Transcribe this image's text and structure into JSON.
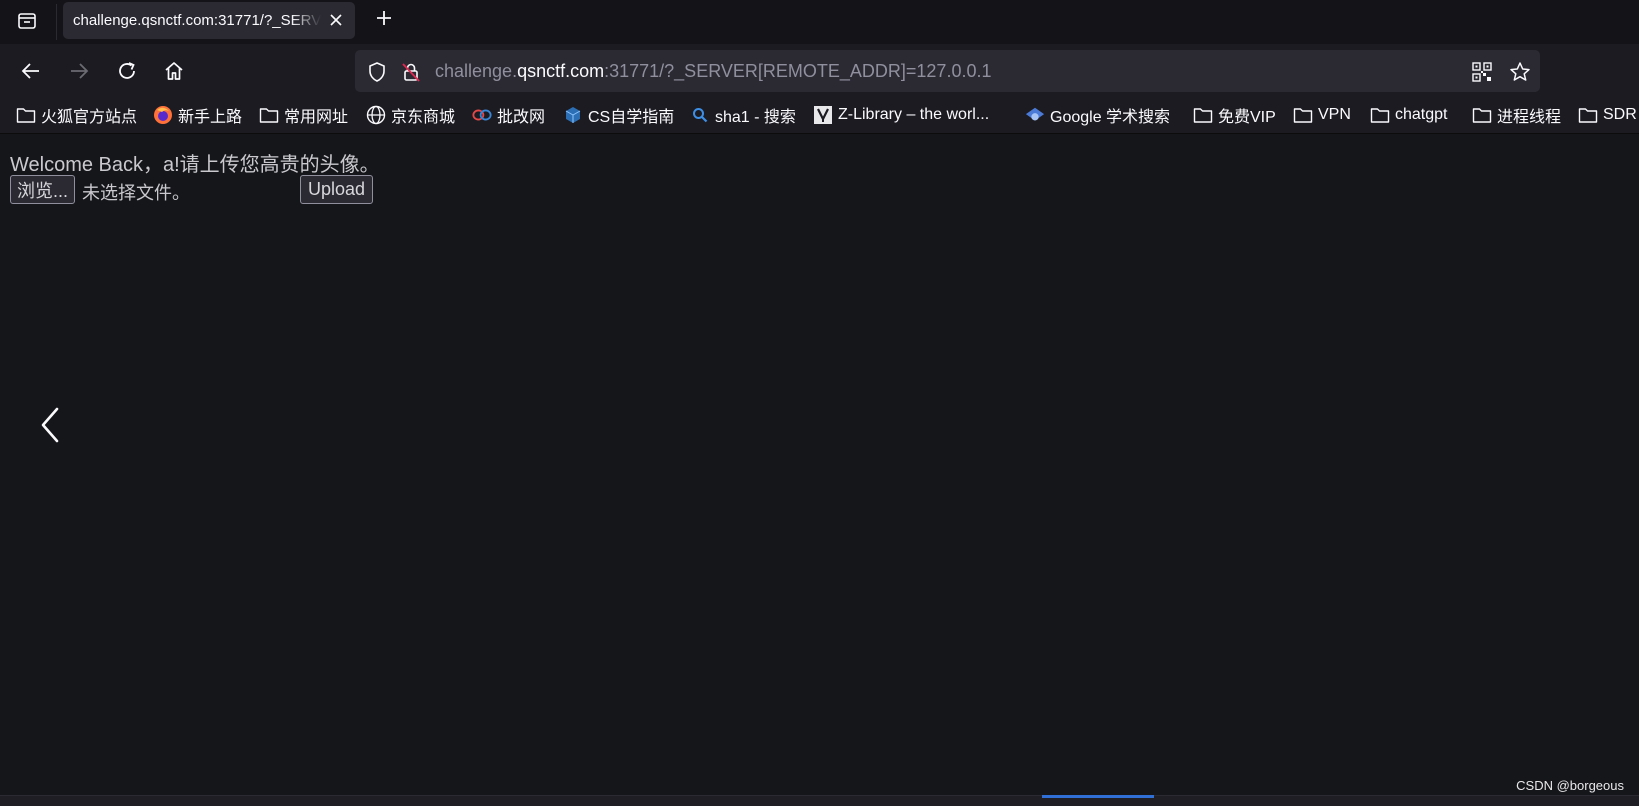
{
  "tab": {
    "title": "challenge.qsnctf.com:31771/?_SERVER[REMOTE_ADDR]=127.0.0.1"
  },
  "urlbar": {
    "prefix": "challenge.",
    "host": "qsnctf.com",
    "suffix": ":31771/?_SERVER[REMOTE_ADDR]=127.0.0.1"
  },
  "bookmarks": [
    {
      "label": "火狐官方站点",
      "icon": "folder-icon"
    },
    {
      "label": "新手上路",
      "icon": "firefox-icon"
    },
    {
      "label": "常用网址",
      "icon": "folder-icon"
    },
    {
      "label": "京东商城",
      "icon": "globe-icon"
    },
    {
      "label": "批改网",
      "icon": "pigai-icon"
    },
    {
      "label": "CS自学指南",
      "icon": "cube-icon"
    },
    {
      "label": "sha1 - 搜索",
      "icon": "search-icon"
    },
    {
      "label": "Z-Library – the worl...",
      "icon": "zlibrary-icon"
    },
    {
      "label": "Google 学术搜索",
      "icon": "scholar-icon"
    },
    {
      "label": "免费VIP",
      "icon": "folder-icon"
    },
    {
      "label": "VPN",
      "icon": "folder-icon"
    },
    {
      "label": "chatgpt",
      "icon": "folder-icon"
    },
    {
      "label": "进程线程",
      "icon": "folder-icon"
    },
    {
      "label": "SDR",
      "icon": "folder-icon"
    }
  ],
  "page": {
    "welcome": "Welcome Back，a!请上传您高贵的头像。",
    "browse_label": "浏览...",
    "no_file_label": "未选择文件。",
    "upload_label": "Upload"
  },
  "watermark": "CSDN @borgeous"
}
